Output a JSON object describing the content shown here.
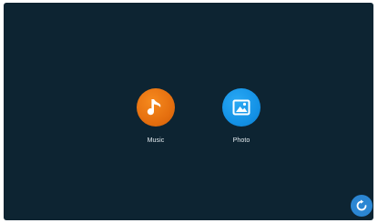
{
  "apps": [
    {
      "id": "music",
      "label": "Music",
      "icon": "music-note-icon",
      "color": "#e56f0f"
    },
    {
      "id": "photo",
      "label": "Photo",
      "icon": "picture-icon",
      "color": "#1492e6"
    }
  ],
  "refresh": {
    "icon": "refresh-icon",
    "color": "#2b86d3"
  },
  "colors": {
    "background": "#0d2432",
    "label": "#e6eef3"
  }
}
